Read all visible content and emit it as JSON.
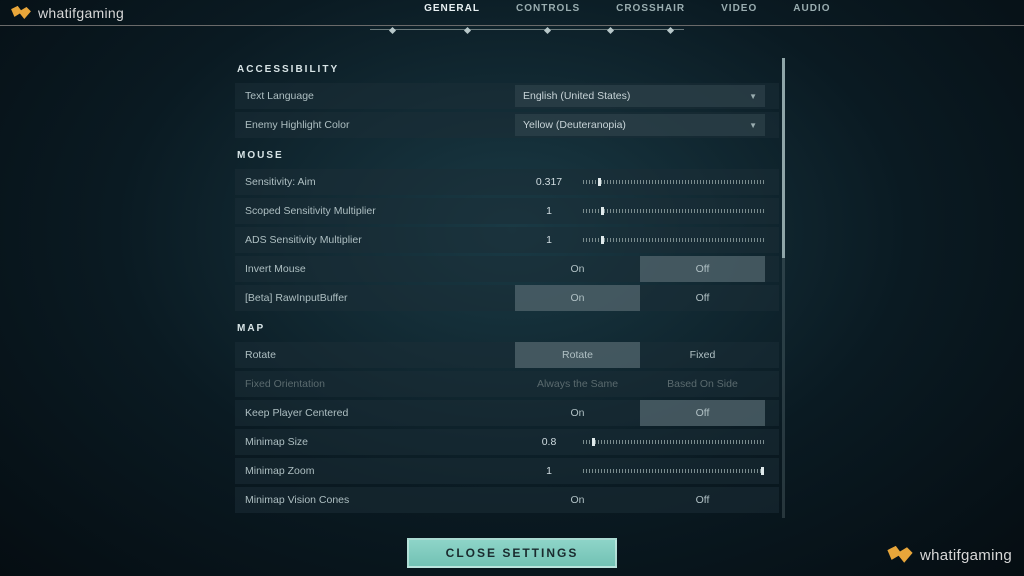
{
  "brand": "whatifgaming",
  "tabs": [
    "GENERAL",
    "CONTROLS",
    "CROSSHAIR",
    "VIDEO",
    "AUDIO"
  ],
  "active_tab": 0,
  "close_label": "CLOSE SETTINGS",
  "sections": {
    "accessibility": {
      "title": "ACCESSIBILITY",
      "text_language": {
        "label": "Text Language",
        "value": "English (United States)"
      },
      "enemy_highlight": {
        "label": "Enemy Highlight Color",
        "value": "Yellow (Deuteranopia)"
      }
    },
    "mouse": {
      "title": "MOUSE",
      "sensitivity_aim": {
        "label": "Sensitivity: Aim",
        "value": "0.317",
        "pct": 8
      },
      "scoped_mult": {
        "label": "Scoped Sensitivity Multiplier",
        "value": "1",
        "pct": 10
      },
      "ads_mult": {
        "label": "ADS Sensitivity Multiplier",
        "value": "1",
        "pct": 10
      },
      "invert": {
        "label": "Invert Mouse",
        "opts": [
          "On",
          "Off"
        ],
        "sel": 1
      },
      "raw_input": {
        "label": "[Beta] RawInputBuffer",
        "opts": [
          "On",
          "Off"
        ],
        "sel": 0
      }
    },
    "map": {
      "title": "MAP",
      "rotate": {
        "label": "Rotate",
        "opts": [
          "Rotate",
          "Fixed"
        ],
        "sel": 0
      },
      "fixed_orientation": {
        "label": "Fixed Orientation",
        "opts": [
          "Always the Same",
          "Based On Side"
        ],
        "sel": -1,
        "disabled": true
      },
      "keep_centered": {
        "label": "Keep Player Centered",
        "opts": [
          "On",
          "Off"
        ],
        "sel": 1
      },
      "minimap_size": {
        "label": "Minimap Size",
        "value": "0.8",
        "pct": 5
      },
      "minimap_zoom": {
        "label": "Minimap Zoom",
        "value": "1",
        "pct": 98
      },
      "vision_cones": {
        "label": "Minimap Vision Cones",
        "opts": [
          "On",
          "Off"
        ],
        "sel": -1
      }
    }
  }
}
